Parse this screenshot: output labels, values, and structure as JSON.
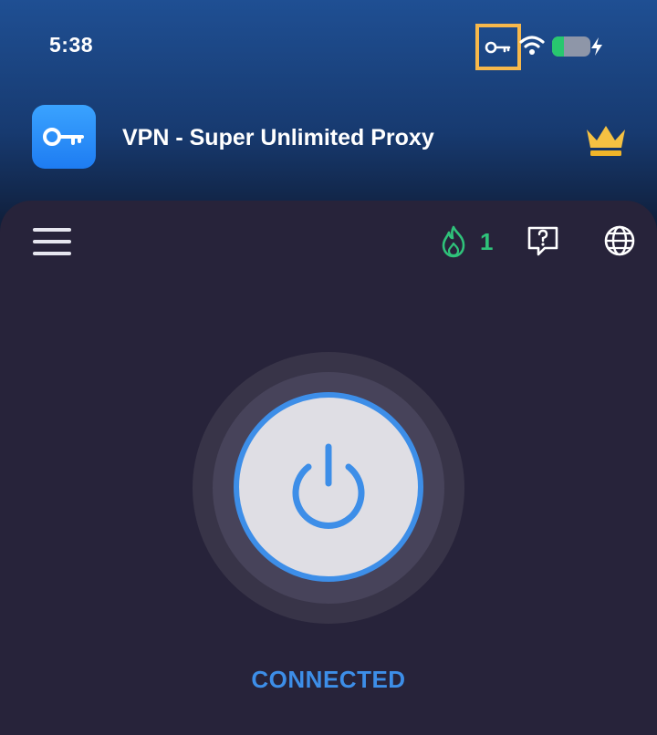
{
  "status_bar": {
    "time": "5:38",
    "battery_level": 0.3,
    "icons": [
      "vpn-key-icon",
      "wifi-icon",
      "battery-icon",
      "charging-bolt-icon"
    ]
  },
  "app_banner": {
    "title": "VPN - Super Unlimited Proxy",
    "icon": "key-icon",
    "premium_icon": "crown-icon"
  },
  "toolbar": {
    "menu_icon": "hamburger-menu-icon",
    "streak_icon": "flame-icon",
    "streak_count": "1",
    "help_icon": "help-question-icon",
    "language_icon": "globe-icon"
  },
  "connection": {
    "button_icon": "power-icon",
    "status": "CONNECTED"
  },
  "colors": {
    "accent_blue": "#3d8ee8",
    "streak_green": "#2fc27a",
    "crown_gold": "#f5c142",
    "highlight_orange": "#f7b84b",
    "panel_bg": "#27233a"
  }
}
